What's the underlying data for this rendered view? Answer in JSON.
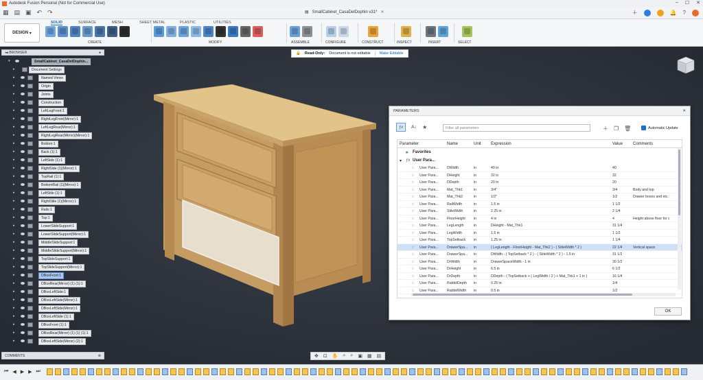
{
  "window": {
    "title": "Autodesk Fusion Personal (Not for Commercial Use)",
    "doc_title": "SmallCabinet_CasaDelDophin v31*"
  },
  "ribbon": {
    "workspace_button": "DESIGN",
    "workspace_tabs": [
      "SOLID",
      "SURFACE",
      "MESH",
      "SHEET METAL",
      "PLASTIC",
      "UTILITIES"
    ],
    "groups": [
      "CREATE",
      "MODIFY",
      "ASSEMBLE",
      "CONFIGURE",
      "CONSTRUCT",
      "INSPECT",
      "INSERT",
      "SELECT"
    ]
  },
  "readonly": {
    "label": "Read-Only:",
    "message": "Document is not editable",
    "action": "Make Editable"
  },
  "browser": {
    "title": "BROWSER",
    "root": "SmallCabinet_CasaDelDophin...",
    "settings": "Document Settings",
    "items": [
      "Named Views",
      "Origin",
      "Joints",
      "Construction",
      "LeftLegFront:1",
      "RightLegFront(Mirror):1",
      "LeftLegRear(Mirror):1",
      "RightLegRear(Mirror)(Mirror):1",
      "Bottom:1",
      "Back (1):1",
      "LeftSide (1):1",
      "RightSide (1)(Mirror):1",
      "TopRail (1):1",
      "BottomRail (1)(Mirror):1",
      "LeftStile (1):1",
      "RightStile (1)(Mirror):1",
      "Rails:1",
      "Top:1",
      "LowerSlideSupport:1",
      "LowerSlideSupport(Mirror):1",
      "MiddleSlideSupport:1",
      "MiddleSlideSupport(Mirror):1",
      "TopSlideSupport:1",
      "TopSlideSupport(Mirror):1",
      "DBoxFront:1",
      "DBoxRear(Mirror) (1) (1):1",
      "DBoxLeftSide:1",
      "DBoxLeftSide(Mirror):1",
      "DBoxLeftSide(Mirror):1",
      "DBoxLeftSide (1):1",
      "DBoxFront (1):1",
      "DBoxRear(Mirror) (1) (1) (1):1",
      "DBoxLeftSide(Mirror) (2):1"
    ]
  },
  "comments": {
    "title": "COMMENTS"
  },
  "parameters": {
    "title": "PARAMETERS",
    "filter_placeholder": "Filter all parameters",
    "auto_update": "Automatic Update",
    "columns": [
      "Parameter",
      "Name",
      "Unit",
      "Expression",
      "Value",
      "Comments"
    ],
    "favorites": "Favorites",
    "user_group": "User Para...",
    "ok": "OK",
    "rows": [
      {
        "param": "User Para...",
        "name": "DWidth",
        "unit": "in",
        "expr": "40 in",
        "value": "40",
        "comment": ""
      },
      {
        "param": "User Para...",
        "name": "DHeight",
        "unit": "in",
        "expr": "32 in",
        "value": "32",
        "comment": ""
      },
      {
        "param": "User Para...",
        "name": "DDepth",
        "unit": "in",
        "expr": "20 in",
        "value": "20",
        "comment": ""
      },
      {
        "param": "User Para...",
        "name": "Mat_Thk1",
        "unit": "in",
        "expr": "3/4\"",
        "value": "3/4",
        "comment": "Body and top"
      },
      {
        "param": "User Para...",
        "name": "Mat_Thk2",
        "unit": "in",
        "expr": "1/2\"",
        "value": "1/2",
        "comment": "Drawer boxes and etc."
      },
      {
        "param": "User Para...",
        "name": "RailWidth",
        "unit": "in",
        "expr": "1.5 in",
        "value": "1 1/2",
        "comment": ""
      },
      {
        "param": "User Para...",
        "name": "StileWidth",
        "unit": "in",
        "expr": "2.25 in",
        "value": "2 1/4",
        "comment": ""
      },
      {
        "param": "User Para...",
        "name": "FloorHeight",
        "unit": "in",
        "expr": "4 in",
        "value": "4",
        "comment": "Height above floor for c"
      },
      {
        "param": "User Para...",
        "name": "LegLength",
        "unit": "in",
        "expr": "DHeight - Mat_Thk1",
        "value": "31 1/4",
        "comment": ""
      },
      {
        "param": "User Para...",
        "name": "LegWidth",
        "unit": "in",
        "expr": "1.5 in",
        "value": "1 1/2",
        "comment": ""
      },
      {
        "param": "User Para...",
        "name": "TopSetback",
        "unit": "in",
        "expr": "1.25 in",
        "value": "1 1/4",
        "comment": ""
      },
      {
        "param": "User Para...",
        "name": "DrawerSpa...",
        "unit": "in",
        "expr": "( LegLength - FloorHeight - Mat_Thk2 ) - ( StileWidth * 2 )",
        "value": "22 1/4",
        "comment": "Vertical space"
      },
      {
        "param": "User Para...",
        "name": "DrawerSpa...",
        "unit": "in",
        "expr": "DWidth - ( TopSetback * 2 ) - ( StileWidth * 2 ) - 1.5 in",
        "value": "31 1/2",
        "comment": ""
      },
      {
        "param": "User Para...",
        "name": "DrWidth",
        "unit": "in",
        "expr": "DrawerSpaceWidth - 1 in",
        "value": "30 1/2",
        "comment": ""
      },
      {
        "param": "User Para...",
        "name": "DrHeight",
        "unit": "in",
        "expr": "6.5 in",
        "value": "6 1/2",
        "comment": ""
      },
      {
        "param": "User Para...",
        "name": "DrDepth",
        "unit": "in",
        "expr": "DDepth - ( TopSetback + ( LegWidth / 2 ) + Mat_Thk1 + 1 in )",
        "value": "16 1/4",
        "comment": ""
      },
      {
        "param": "User Para...",
        "name": "RabbitDepth",
        "unit": "in",
        "expr": "0.25 in",
        "value": "1/4",
        "comment": ""
      },
      {
        "param": "User Para...",
        "name": "RabbitWidth",
        "unit": "in",
        "expr": "0.5 in",
        "value": "1/2",
        "comment": ""
      }
    ]
  }
}
